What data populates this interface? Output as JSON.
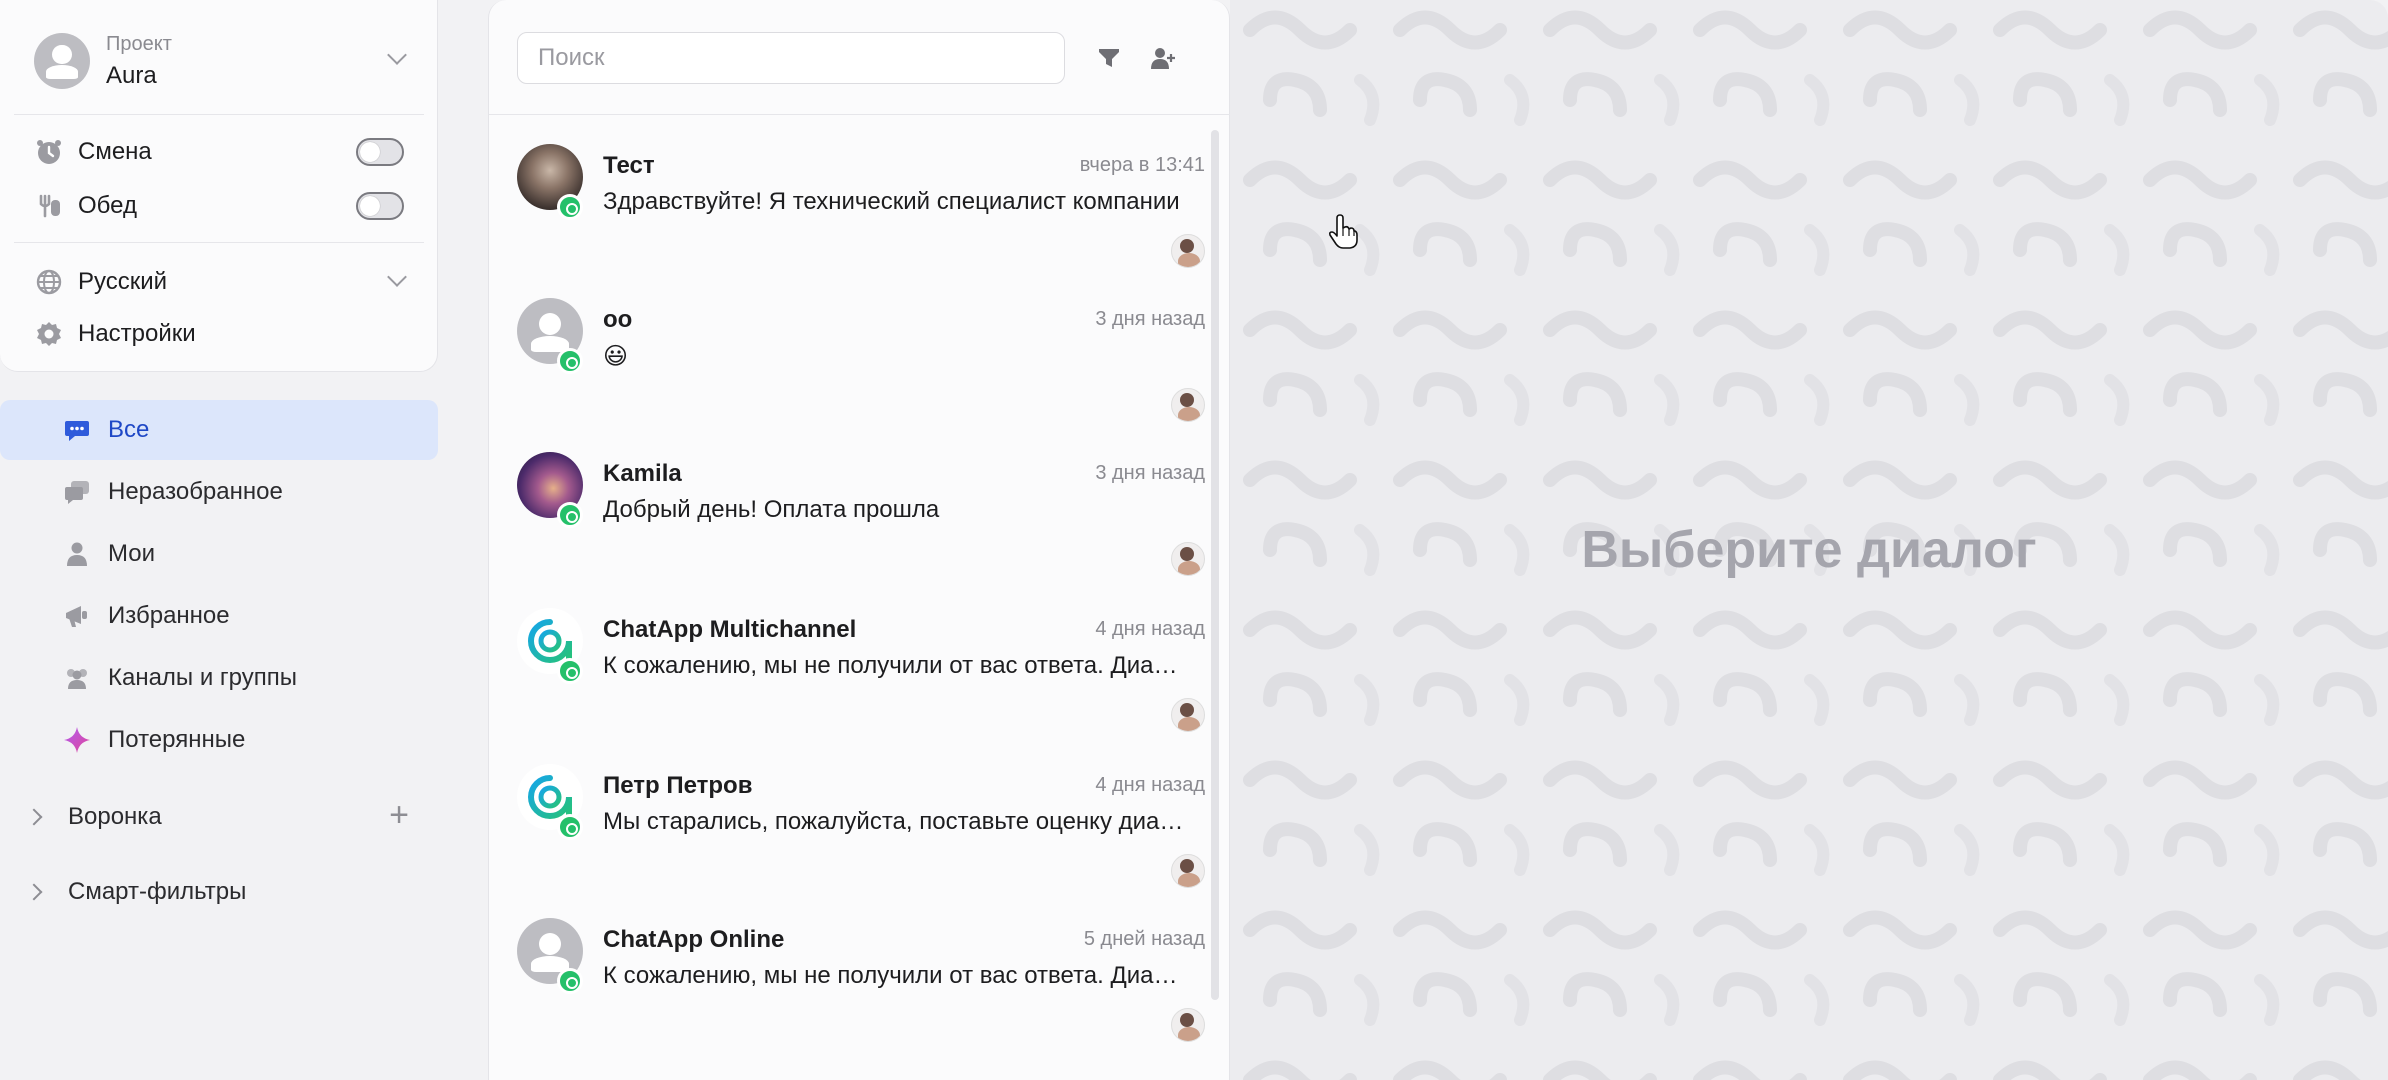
{
  "sidebar": {
    "project": {
      "caption": "Проект",
      "name": "Aura"
    },
    "shift_label": "Смена",
    "lunch_label": "Обед",
    "language_label": "Русский",
    "settings_label": "Настройки",
    "nav": [
      {
        "label": "Все",
        "icon": "chat-bubble-icon"
      },
      {
        "label": "Неразобранное",
        "icon": "chats-icon"
      },
      {
        "label": "Мои",
        "icon": "user-icon"
      },
      {
        "label": "Избранное",
        "icon": "megaphone-icon"
      },
      {
        "label": "Каналы и группы",
        "icon": "users-icon"
      },
      {
        "label": "Потерянные",
        "icon": "sparkle-icon"
      }
    ],
    "funnel_label": "Воронка",
    "smart_filters_label": "Смарт-фильтры"
  },
  "chat_panel": {
    "search_placeholder": "Поиск",
    "chats": [
      {
        "name": "Тест",
        "time": "вчера в 13:41",
        "message": "Здравствуйте! Я технический специалист компании",
        "avatar": "photo-dark"
      },
      {
        "name": "оо",
        "time": "3 дня назад",
        "message": "😃",
        "avatar": "default"
      },
      {
        "name": "Kamila",
        "time": "3 дня назад",
        "message": "Добрый день! Оплата прошла",
        "avatar": "photo-purple"
      },
      {
        "name": "ChatApp Multichannel",
        "time": "4 дня назад",
        "message": "К сожалению, мы не получили от вас ответа. Диалог закрыт",
        "avatar": "chatapp-logo"
      },
      {
        "name": "Петр Петров",
        "time": "4 дня назад",
        "message": "Мы старались, пожалуйста, поставьте оценку диалогу",
        "avatar": "chatapp-logo"
      },
      {
        "name": "ChatApp Online",
        "time": "5 дней назад",
        "message": "К сожалению, мы не получили от вас ответа. Диалог закрыт",
        "avatar": "default"
      }
    ]
  },
  "main": {
    "empty_title": "Выберите диалог"
  },
  "colors": {
    "accent": "#2f5bdb",
    "active_bg": "#dce6fb",
    "whatsapp": "#25c06a"
  }
}
